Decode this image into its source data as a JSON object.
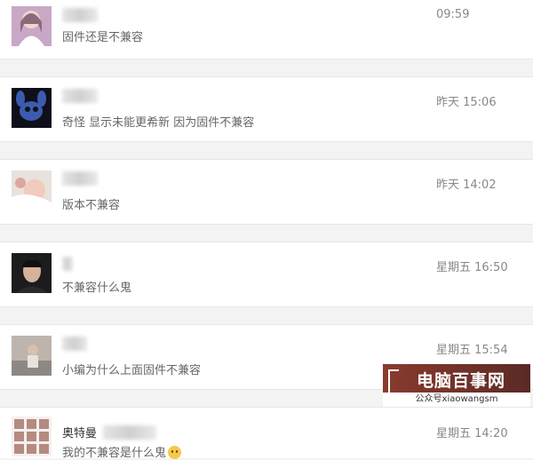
{
  "conversations": [
    {
      "name": "",
      "message": "固件还是不兼容",
      "time": "09:59",
      "avatar_icon": "avatar-girl-photo"
    },
    {
      "name": "",
      "message": "奇怪 显示未能更希新 因为固件不兼容",
      "time": "昨天 15:06",
      "avatar_icon": "avatar-stitch-photo"
    },
    {
      "name": "",
      "message": "版本不兼容",
      "time": "昨天 14:02",
      "avatar_icon": "avatar-baby-photo"
    },
    {
      "name": "",
      "message": "不兼容什么鬼",
      "time": "星期五 16:50",
      "avatar_icon": "avatar-man-photo"
    },
    {
      "name": "",
      "message": "小编为什么上面固件不兼容",
      "time": "星期五 15:54",
      "avatar_icon": "avatar-person-sitting-photo"
    },
    {
      "name": "奥特曼",
      "message": "我的不兼容是什么鬼",
      "time": "星期五 14:20",
      "avatar_icon": "avatar-grid-photo"
    }
  ],
  "watermark": {
    "title": "电脑百事网",
    "subtitle": "公众号xiaowangsm"
  }
}
